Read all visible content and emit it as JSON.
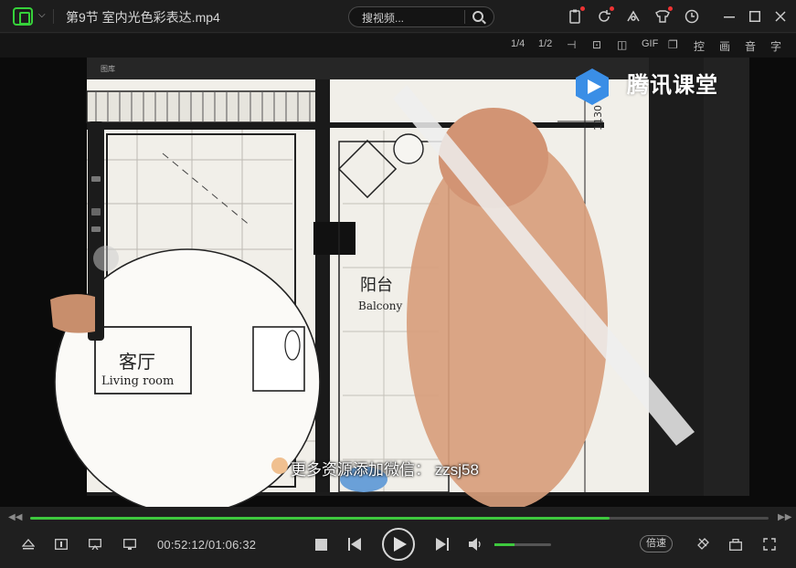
{
  "app": {
    "title": "第9节 室内光色彩表达.mp4"
  },
  "search": {
    "placeholder": "搜视频..."
  },
  "toolbar": {
    "items": [
      "1/4",
      "1/2",
      "GIF",
      "控",
      "画",
      "音",
      "字"
    ]
  },
  "video": {
    "watermark": "腾讯课堂",
    "subtitle": "更多资源添加微信：  zzsj58",
    "drawing": {
      "room1_cn": "客厅",
      "room1_en": "Living room",
      "room2_cn": "阳台",
      "room2_en": "Balcony",
      "dimension": "1130",
      "app_menu": "图库"
    }
  },
  "player": {
    "current_time": "00:52:12",
    "total_time": "01:06:32",
    "time_display": "00:52:12/01:06:32",
    "progress_fraction": 0.785,
    "volume_fraction": 0.35,
    "speed_label": "倍速"
  },
  "colors": {
    "accent": "#3ec93e",
    "bg": "#1f1f1f"
  }
}
